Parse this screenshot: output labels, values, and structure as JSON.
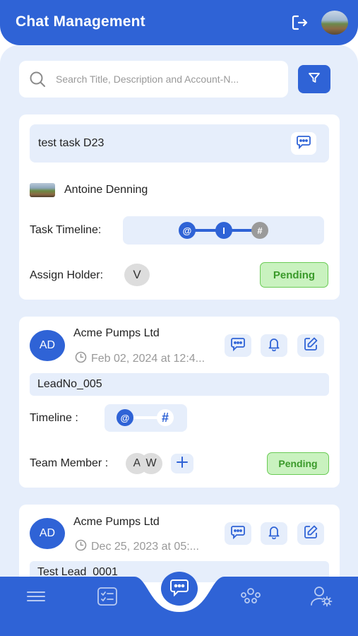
{
  "header": {
    "title": "Chat Management",
    "logout_icon": "logout-icon",
    "avatar_icon": "profile-avatar"
  },
  "search": {
    "placeholder": "Search Title, Description and Account-N...",
    "value": "",
    "filter_icon": "filter-icon"
  },
  "task_card": {
    "title": "test task D23",
    "owner_name": "Antoine Denning",
    "timeline_label": "Task Timeline:",
    "timeline_nodes": [
      "@",
      "I",
      "#"
    ],
    "assign_label": "Assign Holder:",
    "assign_holder": "V",
    "status": "Pending"
  },
  "leads": [
    {
      "initials": "AD",
      "company": "Acme Pumps Ltd",
      "date": "Feb 02, 2024 at 12:4...",
      "lead_no": "LeadNo_005",
      "timeline_label": "Timeline :",
      "timeline_nodes": [
        "@",
        "#"
      ],
      "team_label": "Team Member :",
      "members": [
        "A",
        "W"
      ],
      "status": "Pending"
    },
    {
      "initials": "AD",
      "company": "Acme Pumps Ltd",
      "date": "Dec 25, 2023 at 05:...",
      "lead_no": "Test Lead_0001"
    }
  ],
  "bottom_nav": {
    "items": [
      "menu-icon",
      "task-list-icon",
      "chat-icon",
      "team-icon",
      "user-settings-icon"
    ],
    "active": "chat-icon"
  },
  "colors": {
    "primary": "#2f63d6",
    "background": "#e6eefb",
    "pending_bg": "#c9f2bf",
    "pending_text": "#3a9a2a"
  }
}
